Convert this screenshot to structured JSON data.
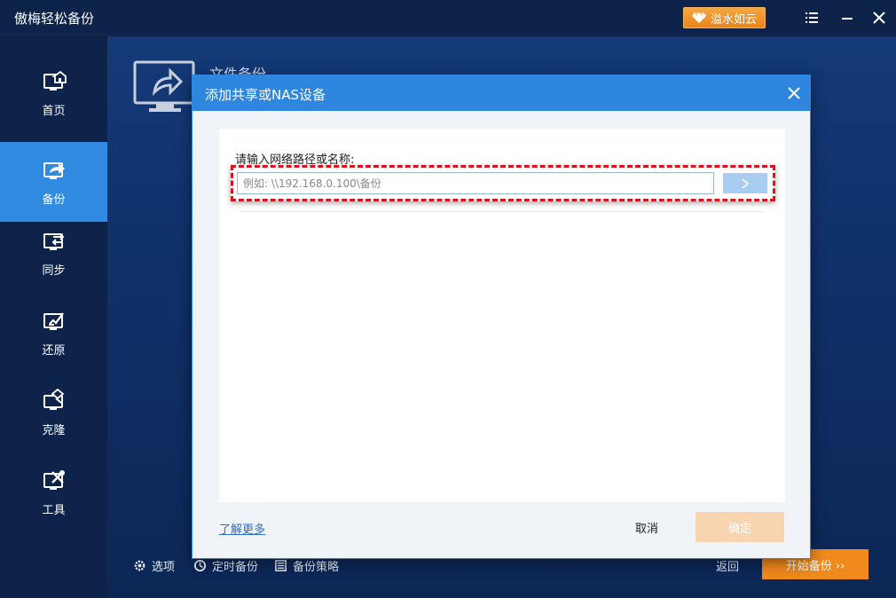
{
  "app": {
    "title": "傲梅轻松备份",
    "upgrade_label": "溢水如云",
    "icons": [
      "menu-icon",
      "minimize-icon",
      "close-icon",
      "diamond-icon"
    ]
  },
  "sidebar": {
    "items": [
      {
        "label": "首页",
        "icon": "home-icon",
        "active": false
      },
      {
        "label": "备份",
        "icon": "backup-icon",
        "active": true
      },
      {
        "label": "同步",
        "icon": "sync-icon",
        "active": false
      },
      {
        "label": "还原",
        "icon": "restore-icon",
        "active": false
      },
      {
        "label": "克隆",
        "icon": "clone-icon",
        "active": false
      },
      {
        "label": "工具",
        "icon": "tools-icon",
        "active": false
      }
    ]
  },
  "main": {
    "section_title": "文件备份",
    "bottom": {
      "options_label": "选项",
      "schedule_label": "定时备份",
      "strategy_label": "备份策略",
      "back_label": "返回",
      "start_label": "开始备份 ››"
    }
  },
  "dialog": {
    "title": "添加共享或NAS设备",
    "path_label": "请输入网络路径或名称:",
    "path_placeholder": "例如: \\\\192.168.0.100\\备份",
    "path_value": "",
    "learn_more": "了解更多",
    "cancel": "取消",
    "ok": "确定"
  },
  "colors": {
    "accent_blue": "#2e86de",
    "sidebar_active": "#2f8ae0",
    "orange": "#f08a1c",
    "highlight_red": "#d9121b"
  }
}
